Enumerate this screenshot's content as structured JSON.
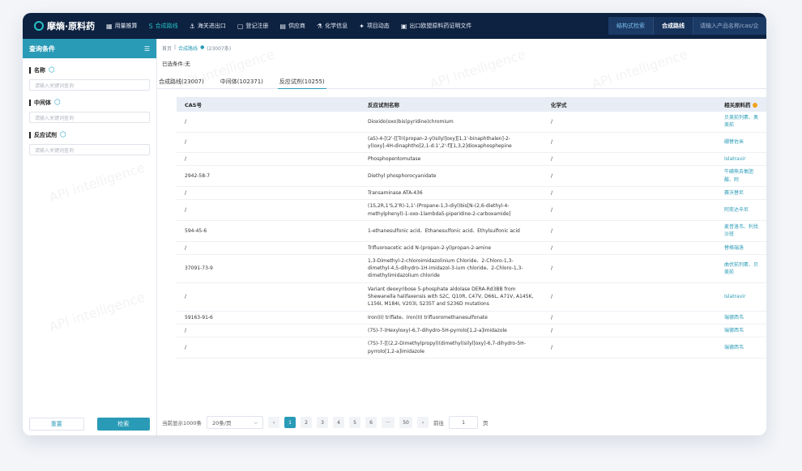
{
  "nav": {
    "brand": "摩熵·原料药",
    "links": [
      {
        "label": "用量推算",
        "icon": "▦"
      },
      {
        "label": "合成路线",
        "icon": "S",
        "active": true
      },
      {
        "label": "海关进出口",
        "icon": "⚓"
      },
      {
        "label": "登记注册",
        "icon": "▢"
      },
      {
        "label": "供应商",
        "icon": "▤"
      },
      {
        "label": "化学信息",
        "icon": "⚗"
      },
      {
        "label": "项目动态",
        "icon": "✦"
      },
      {
        "label": "出口欧盟原料药证明文件",
        "icon": "▣"
      }
    ],
    "search_modes": [
      "结构式检索",
      "合成路线"
    ],
    "search_placeholder": "请输入产品名称/cas/企"
  },
  "sidebar": {
    "title": "查询条件",
    "fields": [
      {
        "label": "名称",
        "placeholder": "请输入关键词查询"
      },
      {
        "label": "中间体",
        "placeholder": "请输入关键词查询"
      },
      {
        "label": "反应试剂",
        "placeholder": "请输入关键词查询"
      }
    ],
    "reset_label": "重置",
    "search_label": "检索"
  },
  "main": {
    "breadcrumb": {
      "home": "首页",
      "sep": "|",
      "current": "合成路线",
      "count": "(23007条)"
    },
    "selected": "已选条件:无",
    "tabs": [
      "合成路线(23007)",
      "中间体(102371)",
      "反应试剂(10255)"
    ],
    "columns": [
      "CAS号",
      "反应试剂名称",
      "化学式",
      "相关原料药"
    ],
    "rows": [
      {
        "cas": "/",
        "name": "Dioxido(oxo)bis(pyridine)chromium",
        "formula": "/",
        "api": "贝美前列素、奥美前"
      },
      {
        "cas": "/",
        "name": "(aS)-4-[(2'-[[Tri(propan-2-yl)silyl]oxy][1,1'-binaphthalen]-2-yl)oxy]-4H-dinaphtho[2,1-d:1',2'-f][1,3,2]dioxaphosphepine",
        "formula": "/",
        "api": "硼替佐米"
      },
      {
        "cas": "/",
        "name": "Phosphopentomutase",
        "formula": "/",
        "api": "Islatravir"
      },
      {
        "cas": "2942-58-7",
        "name": "Diethyl phosphorocyanidate",
        "formula": "/",
        "api": "牛磺熊去氧胆酸、阿"
      },
      {
        "cas": "/",
        "name": "Transaminase ATA-436",
        "formula": "/",
        "api": "赛沃替尼"
      },
      {
        "cas": "/",
        "name": "(1S,2R,1'S,2'R)-1,1'-(Propane-1,3-diyl)bis[N-(2,6-diethyl-4-methylphenyl)-1-oxo-1lambda5-piperidine-2-carboxamide]",
        "formula": "/",
        "api": "阿奕达辛尼"
      },
      {
        "cas": "594-45-6",
        "name": "1-ethanesulfonic acid、Ethanesulfonic acid、Ethylsulfonic acid",
        "formula": "/",
        "api": "麦昔洛韦、利伐沙班"
      },
      {
        "cas": "/",
        "name": "Trifluoroacetic acid N-(propan-2-yl)propan-2-amine",
        "formula": "/",
        "api": "替格瑞洛"
      },
      {
        "cas": "37091-73-9",
        "name": "1,3-Dimethyl-2-chloroimidazolinium Chloride、2-Chloro-1,3-dimethyl-4,5-dihydro-1H-imidazol-3-ium chloride、2-Chloro-1,3-dimethylimidazolium chloride",
        "formula": "/",
        "api": "曲伏前列素、贝美前"
      },
      {
        "cas": "/",
        "name": "Variant deoxyribose 5-phosphate aldolase DERA-Rd3BB from Shewanella halifaxensis with S2C, Q10R, C47V, D66L, A71V, A145K, L156I, M184I, V203I, S235T and S236D mutations",
        "formula": "/",
        "api": "Islatravir"
      },
      {
        "cas": "59163-91-6",
        "name": "Iron(II) triflate、Iron(II) trifluoromethanesulfonate",
        "formula": "/",
        "api": "瑞德西韦"
      },
      {
        "cas": "/",
        "name": "(7S)-7-(Hexyloxy)-6,7-dihydro-5H-pyrrolo[1,2-a]imidazole",
        "formula": "/",
        "api": "瑞德西韦"
      },
      {
        "cas": "/",
        "name": "(7S)-7-[[(2,2-Dimethylpropyl)(dimethyl)silyl]oxy]-6,7-dihydro-5H-pyrrolo[1,2-a]imidazole",
        "formula": "/",
        "api": "瑞德西韦"
      }
    ]
  },
  "pager": {
    "total_label": "当前显示1000条",
    "page_size": "20条/页",
    "pages": [
      "1",
      "2",
      "3",
      "4",
      "5",
      "6",
      "···",
      "50"
    ],
    "goto_label": "前往",
    "goto_value": "1",
    "page_unit": "页"
  },
  "watermark": "API intelligence",
  "colors": {
    "nav_bg": "#0d2140",
    "accent": "#2a9bb6",
    "header_bg": "#e8edf5"
  }
}
